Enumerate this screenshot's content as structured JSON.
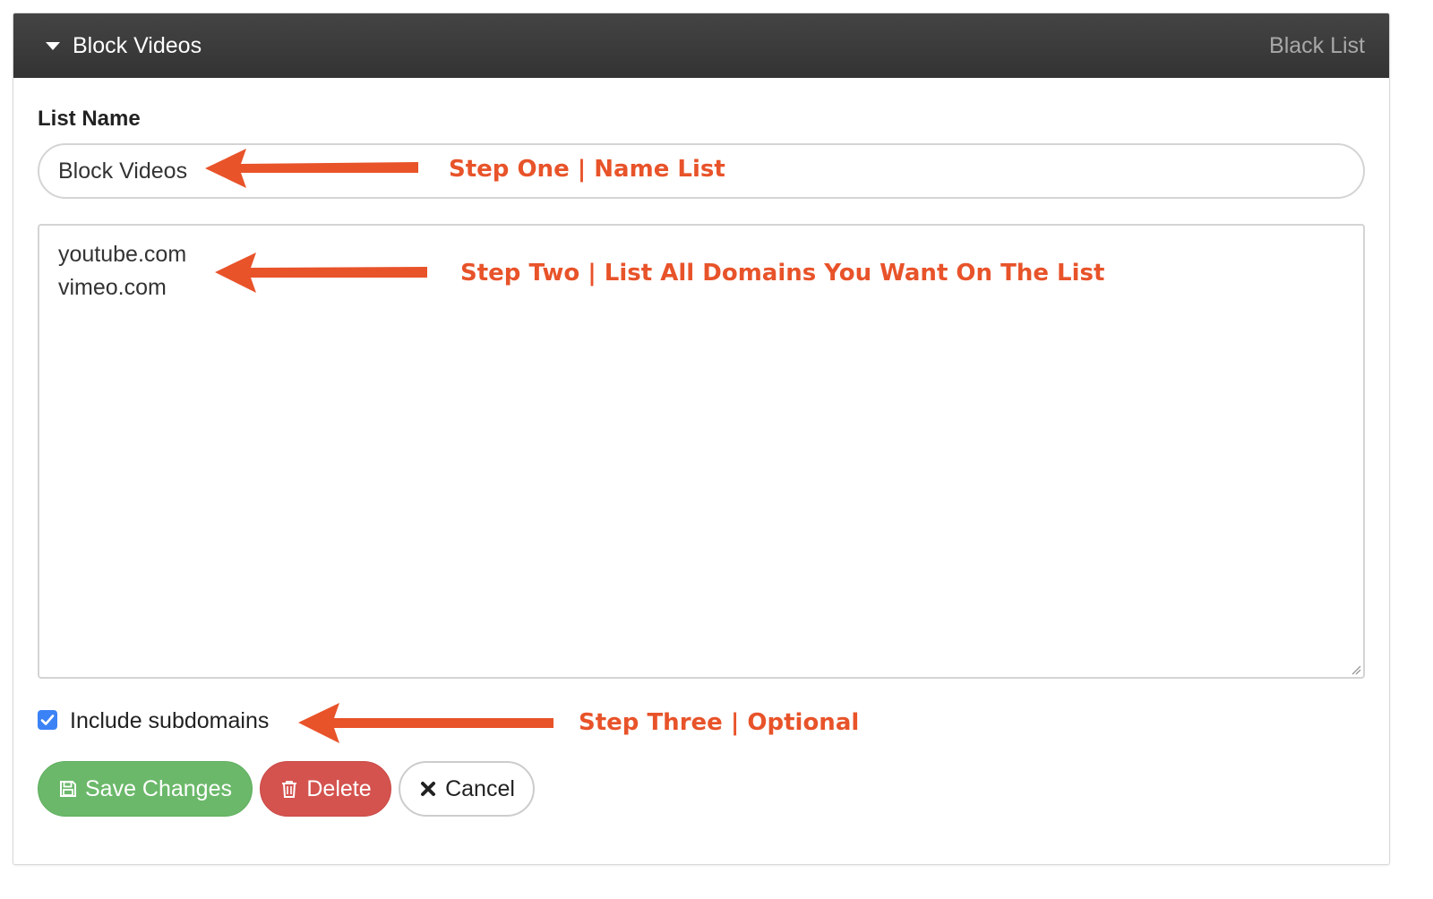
{
  "header": {
    "title": "Block Videos",
    "list_type": "Black List"
  },
  "form": {
    "list_name_label": "List Name",
    "list_name_value": "Block Videos",
    "domains_value": "youtube.com\nvimeo.com",
    "include_subdomains_label": "Include subdomains",
    "include_subdomains_checked": true
  },
  "buttons": {
    "save_label": "Save Changes",
    "delete_label": "Delete",
    "cancel_label": "Cancel"
  },
  "annotations": {
    "step_one": "Step One | Name List",
    "step_two": "Step Two | List All Domains You Want On The List",
    "step_three": "Step Three | Optional"
  },
  "icons": {
    "header_toggle": "caret-down-icon",
    "save": "floppy-disk-icon",
    "delete": "trash-icon",
    "cancel": "close-icon",
    "checkbox": "checkmark-icon",
    "annotation_arrow": "arrow-left-icon"
  },
  "colors": {
    "header_bg": "#3a3a3a",
    "save_button": "#6bb86a",
    "delete_button": "#d4534f",
    "annotation": "#e8532a",
    "checkbox": "#3b82f6"
  }
}
